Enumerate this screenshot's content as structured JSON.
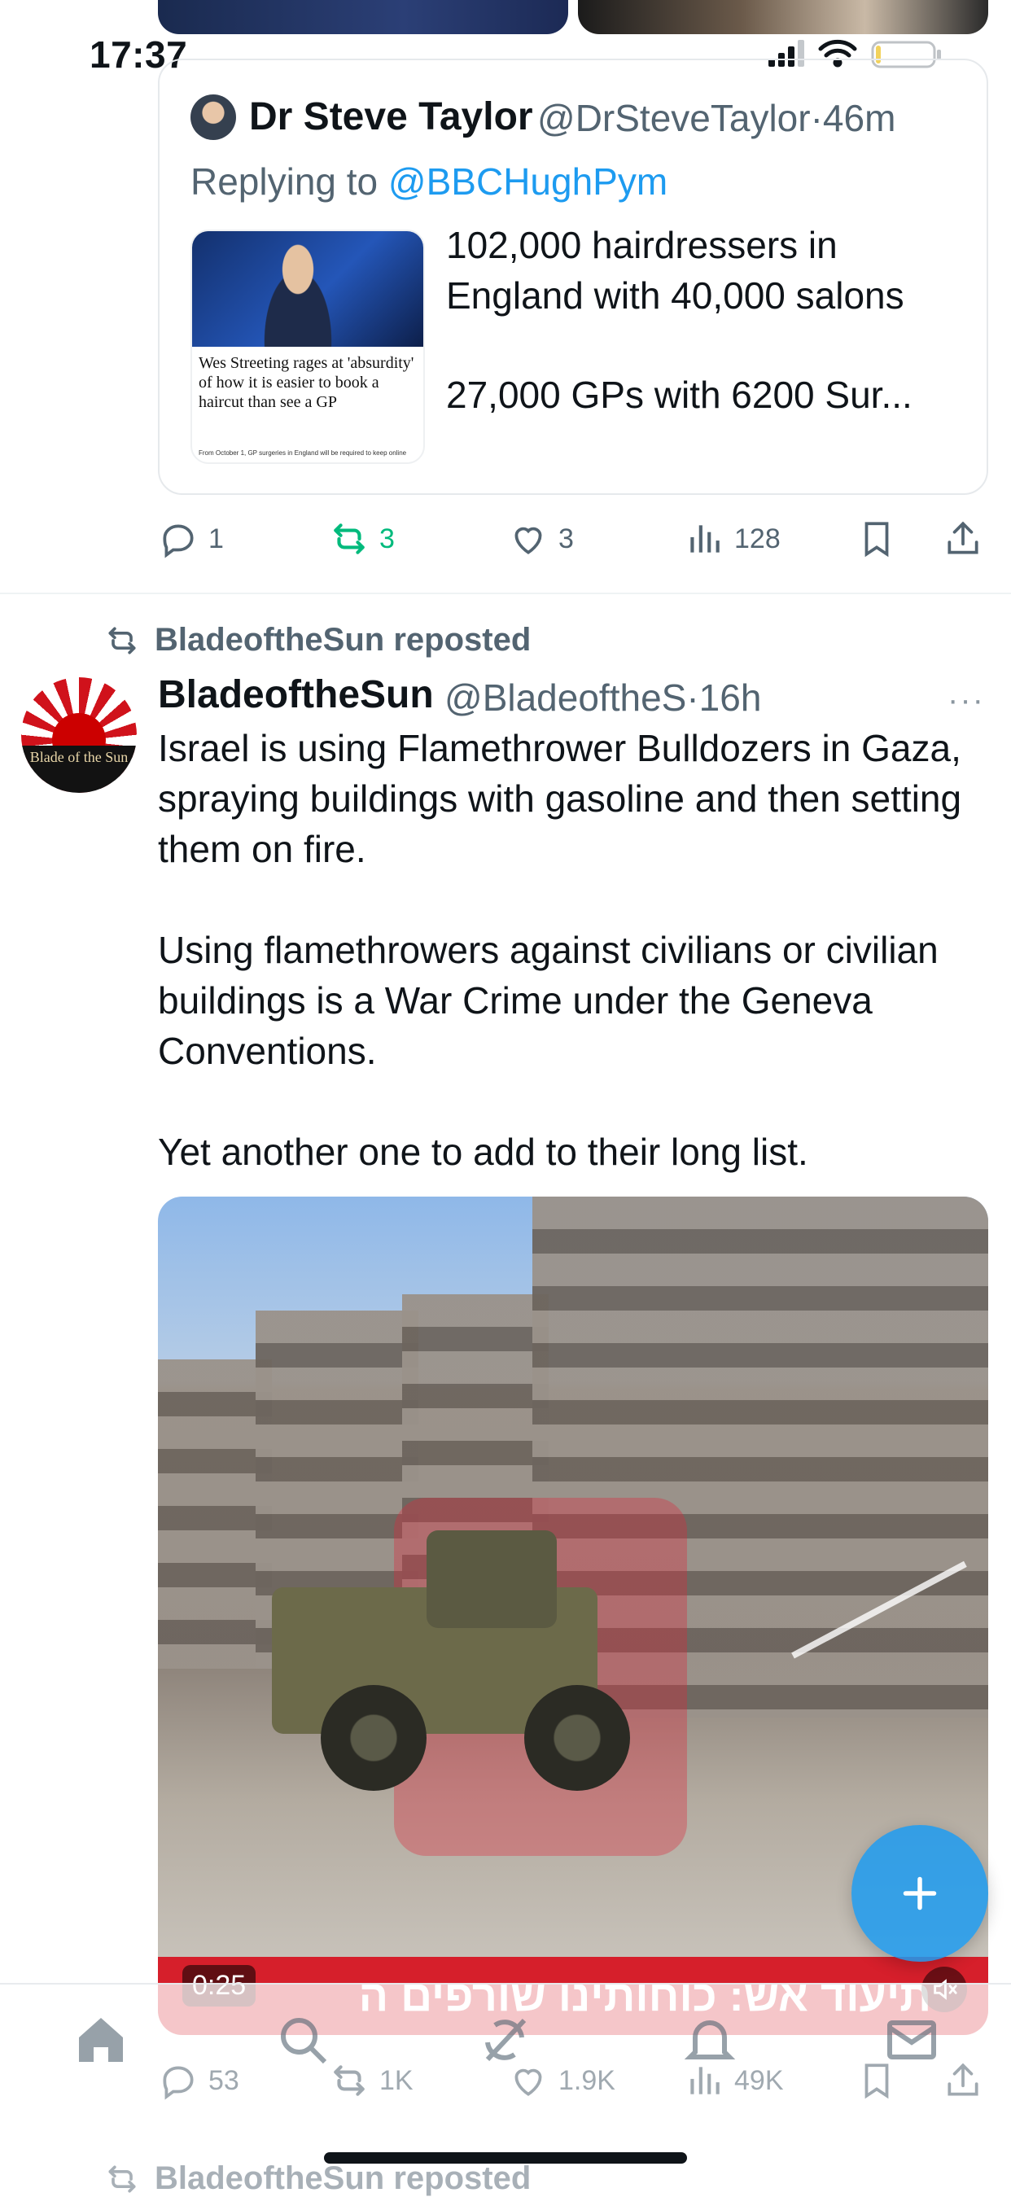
{
  "status_bar": {
    "time": "17:37"
  },
  "quoted_tweet": {
    "author_name": "Dr Steve Taylor",
    "author_handle": "@DrSteveTaylor",
    "time": "46m",
    "replying_prefix": "Replying to",
    "replying_to": "@BBCHughPym",
    "thumbnail_headline": "Wes Streeting rages at 'absurdity' of how it is easier to book a haircut than see a GP",
    "thumbnail_caption": "From October 1, GP surgeries in England will be required to keep online",
    "text_line1": "102,000 hairdressers in England with 40,000 salons",
    "text_line2": "27,000 GPs with 6200 Sur..."
  },
  "quoted_actions": {
    "replies": "1",
    "reposts": "3",
    "likes": "3",
    "views": "128"
  },
  "main_tweet": {
    "repost_label": "BladeoftheSun reposted",
    "avatar_text": "Blade of the Sun",
    "author_name": "BladeoftheSun",
    "author_handle": "@BladeoftheS",
    "time": "16h",
    "more": "···",
    "paragraphs": [
      "Israel is using Flamethrower Bulldozers in Gaza, spraying buildings with gasoline and then setting them on fire.",
      "Using flamethrowers against civilians or civilian buildings is a War Crime under the Geneva Conventions.",
      "Yet another one to add to their long list."
    ],
    "video": {
      "duration": "0:25",
      "ticker_text": "תיעוד אש: כוחותינו שורפים ה"
    }
  },
  "main_actions": {
    "replies": "53",
    "reposts": "1K",
    "likes": "1.9K",
    "views": "49K"
  },
  "next_tweet": {
    "repost_label": "BladeoftheSun reposted"
  },
  "colors": {
    "accent": "#1d9bf0",
    "repost_green": "#00ba7c",
    "muted": "#536471",
    "ticker_red": "#d61f2b"
  }
}
